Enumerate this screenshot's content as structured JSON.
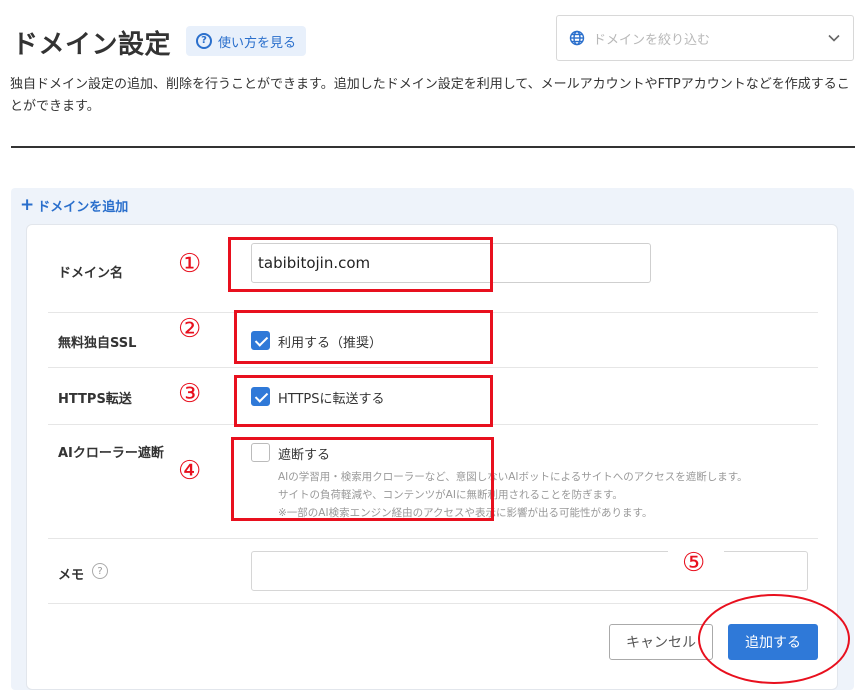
{
  "header": {
    "title": "ドメイン設定",
    "help_label": "使い方を見る",
    "filter_placeholder": "ドメインを絞り込む"
  },
  "description": "独自ドメイン設定の追加、削除を行うことができます。追加したドメイン設定を利用して、メールアカウントやFTPアカウントなどを作成することができます。",
  "panel": {
    "add_label": "ドメインを追加"
  },
  "form": {
    "domain": {
      "label": "ドメイン名",
      "value": "tabibitojin.com"
    },
    "ssl": {
      "label": "無料独自SSL",
      "option": "利用する（推奨）",
      "checked": true
    },
    "https": {
      "label": "HTTPS転送",
      "option": "HTTPSに転送する",
      "checked": true
    },
    "ai": {
      "label": "AIクローラー遮断",
      "option": "遮断する",
      "checked": false,
      "notes": [
        "AIの学習用・検索用クローラーなど、意図しないAIボットによるサイトへのアクセスを遮断します。",
        "サイトの負荷軽減や、コンテンツがAIに無断利用されることを防ぎます。",
        "※一部のAI検索エンジン経由のアクセスや表示に影響が出る可能性があります。"
      ]
    },
    "memo": {
      "label": "メモ",
      "value": ""
    }
  },
  "actions": {
    "cancel_label": "キャンセル",
    "submit_label": "追加する"
  },
  "annotations": {
    "n1": "①",
    "n2": "②",
    "n3": "③",
    "n4": "④",
    "n5": "⑤",
    "color": "#e8101e"
  },
  "colors": {
    "accent": "#2f79d8",
    "link": "#2a6fcc",
    "panel_bg": "#eef3fa"
  }
}
